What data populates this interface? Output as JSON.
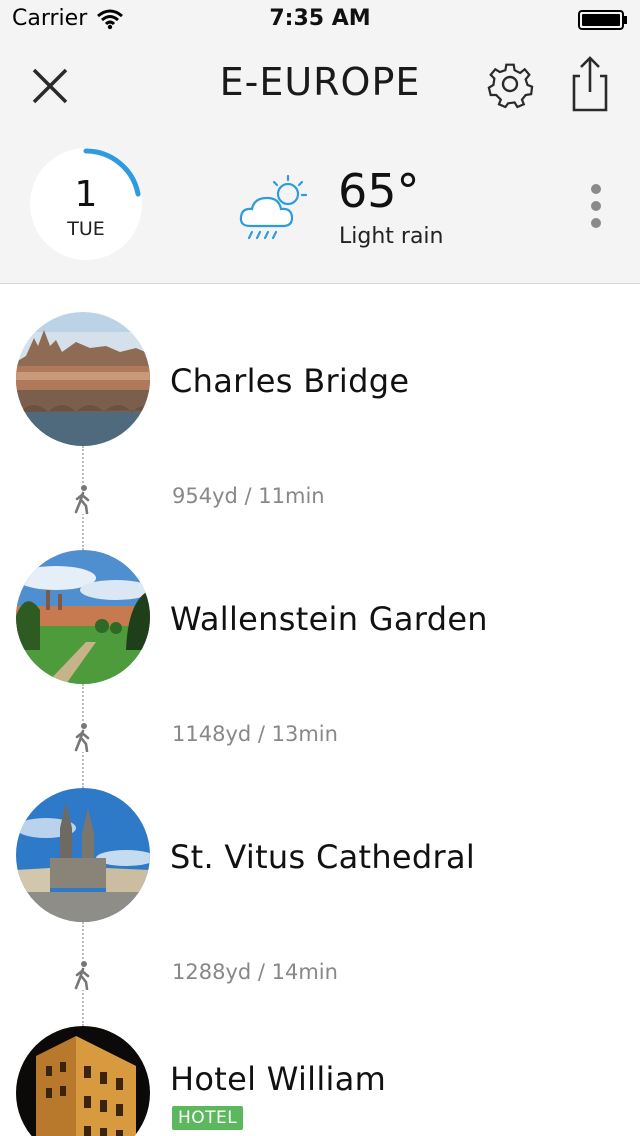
{
  "status_bar": {
    "carrier": "Carrier",
    "time": "7:35 AM",
    "wifi_icon": "wifi-icon",
    "battery_icon": "battery-full-icon"
  },
  "nav": {
    "title": "E-EUROPE",
    "close_icon": "close-icon",
    "settings_icon": "gear-icon",
    "share_icon": "share-icon"
  },
  "day": {
    "number": "1",
    "weekday": "TUE",
    "progress_fraction": 0.22,
    "accent_color": "#2e9be0"
  },
  "weather": {
    "temperature": "65°",
    "condition": "Light rain",
    "icon": "partly-cloudy-rain-icon",
    "icon_color": "#2e9be0"
  },
  "itinerary": {
    "places": [
      {
        "name": "Charles Bridge",
        "photo": "charles-bridge-photo"
      },
      {
        "name": "Wallenstein Garden",
        "photo": "wallenstein-garden-photo"
      },
      {
        "name": "St. Vitus Cathedral",
        "photo": "st-vitus-cathedral-photo"
      },
      {
        "name": "Hotel William",
        "photo": "hotel-william-photo",
        "badge": "HOTEL",
        "badge_color": "#5cb85c"
      }
    ],
    "legs": [
      {
        "text": "954yd / 11min",
        "mode_icon": "walking-icon"
      },
      {
        "text": "1148yd / 13min",
        "mode_icon": "walking-icon"
      },
      {
        "text": "1288yd / 14min",
        "mode_icon": "walking-icon"
      }
    ]
  }
}
